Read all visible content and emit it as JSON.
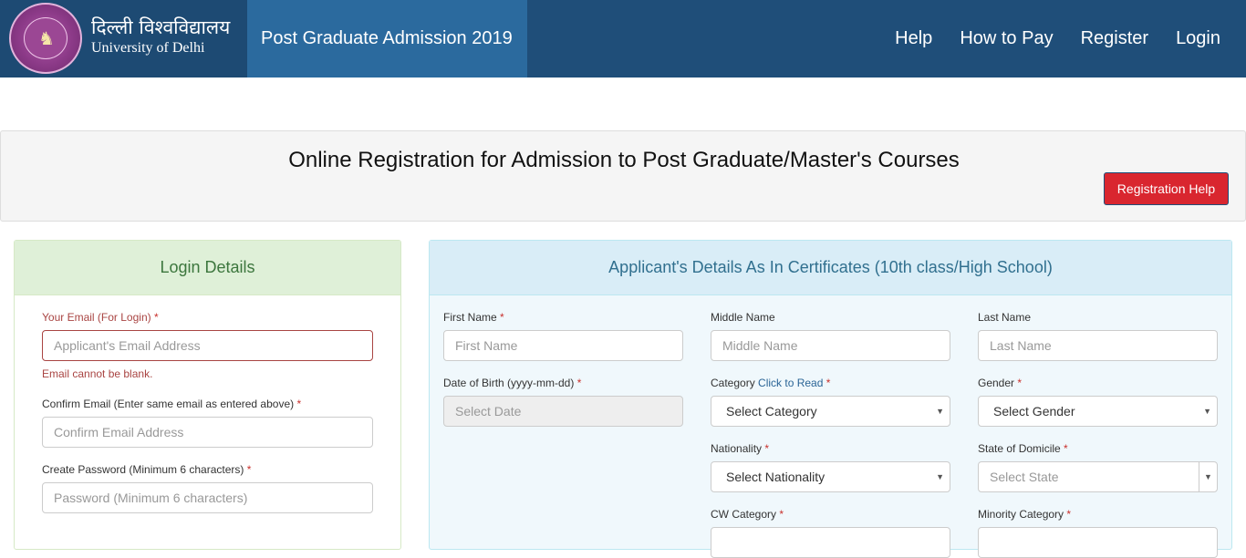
{
  "header": {
    "brand_hindi": "दिल्ली विश्वविद्यालय",
    "brand_en": "University of Delhi",
    "active_title": "Post Graduate Admission 2019",
    "nav": [
      "Help",
      "How to Pay",
      "Register",
      "Login"
    ]
  },
  "title_panel": {
    "heading": "Online Registration for Admission to Post Graduate/Master's Courses",
    "help_button": "Registration Help"
  },
  "login": {
    "heading": "Login Details",
    "email_label": "Your Email (For Login)",
    "email_placeholder": "Applicant's Email Address",
    "email_error": "Email cannot be blank.",
    "confirm_label": "Confirm Email (Enter same email as entered above)",
    "confirm_placeholder": "Confirm Email Address",
    "password_label": "Create Password (Minimum 6 characters)",
    "password_placeholder": "Password (Minimum 6 characters)",
    "required_mark": "*"
  },
  "applicant": {
    "heading": "Applicant's Details As In Certificates (10th class/High School)",
    "first_name_label": "First Name",
    "first_name_placeholder": "First Name",
    "middle_name_label": "Middle Name",
    "middle_name_placeholder": "Middle Name",
    "last_name_label": "Last Name",
    "last_name_placeholder": "Last Name",
    "dob_label": "Date of Birth (yyyy-mm-dd)",
    "dob_placeholder": "Select Date",
    "category_label": "Category",
    "category_link": "Click to Read",
    "category_value": "Select Category",
    "gender_label": "Gender",
    "gender_value": "Select Gender",
    "nationality_label": "Nationality",
    "nationality_value": "Select Nationality",
    "state_label": "State of Domicile",
    "state_value": "Select State",
    "cw_label": "CW Category",
    "minority_label": "Minority Category",
    "required_mark": "*"
  },
  "colors": {
    "navbar": "#1f4e79",
    "nav_active": "#2b6a9e",
    "help_button": "#d9262f",
    "error": "#a94442"
  },
  "icons": {
    "logo": "university-seal-icon",
    "caret": "caret-down-icon"
  }
}
